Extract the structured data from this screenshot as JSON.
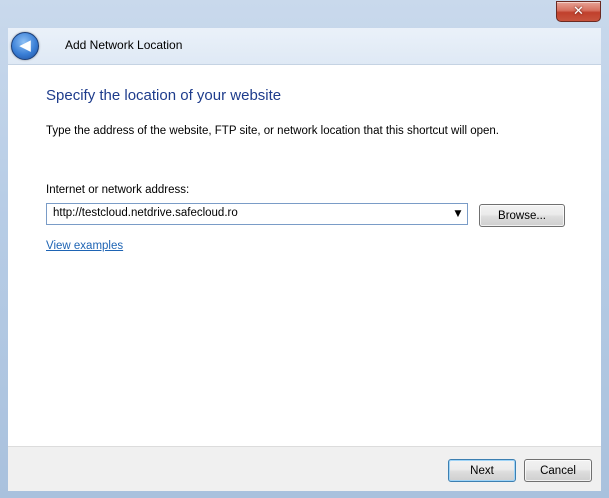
{
  "window": {
    "title": "Add Network Location",
    "close_symbol": "✕",
    "back_symbol": "◀"
  },
  "content": {
    "heading": "Specify the location of your website",
    "description": "Type the address of the website, FTP site, or network location that this shortcut will open.",
    "address_label": "Internet or network address:",
    "address_value": "http://testcloud.netdrive.safecloud.ro",
    "browse_label": "Browse...",
    "examples_link": "View examples"
  },
  "footer": {
    "next_label": "Next",
    "cancel_label": "Cancel"
  },
  "colors": {
    "heading": "#1e3c8c",
    "link": "#1e64b4",
    "close_button": "#c7533d"
  }
}
